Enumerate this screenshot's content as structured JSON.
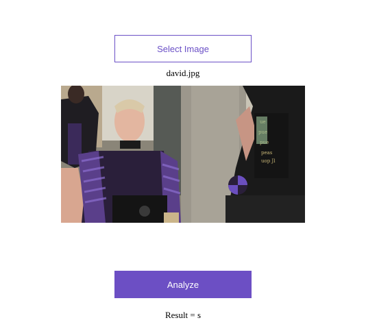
{
  "upload": {
    "select_label": "Select Image",
    "filename": "david.jpg"
  },
  "actions": {
    "analyze_label": "Analyze"
  },
  "result": {
    "text": "Result = s"
  },
  "colors": {
    "accent": "#6c4fc4",
    "accent_outline": "#6a4fc6"
  }
}
